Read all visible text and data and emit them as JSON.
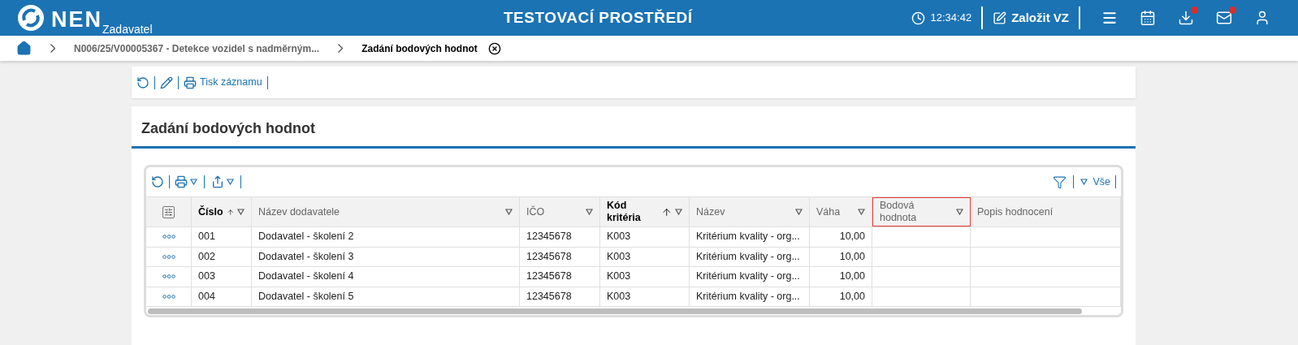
{
  "header": {
    "logo": "NEN",
    "role": "Zadavatel",
    "title": "TESTOVACÍ PROSTŘEDÍ",
    "time": "12:34:42",
    "create_button": "Založit VZ",
    "icons": [
      {
        "kind": "menu",
        "badge": false
      },
      {
        "kind": "calendar",
        "badge": false
      },
      {
        "kind": "download",
        "badge": true
      },
      {
        "kind": "mail",
        "badge": true
      },
      {
        "kind": "user",
        "badge": false
      }
    ]
  },
  "breadcrumb": {
    "items": [
      {
        "label": "N006/25/V00005367 - Detekce vozidel s nadměrným...",
        "current": false
      },
      {
        "label": "Zadání bodových hodnot",
        "current": true
      }
    ]
  },
  "toolbar": {
    "print_label": "Tisk záznamu"
  },
  "section": {
    "title": "Zadání bodových hodnot"
  },
  "grid": {
    "filter_label": "Vše",
    "columns": [
      {
        "label": "Číslo",
        "sorted": true,
        "filterable": true,
        "highlighted": false,
        "kind": "text"
      },
      {
        "label": "Název dodavatele",
        "sorted": false,
        "filterable": true,
        "highlighted": false,
        "kind": "text"
      },
      {
        "label": "IČO",
        "sorted": false,
        "filterable": true,
        "highlighted": false,
        "kind": "text"
      },
      {
        "label": "Kód kritéria",
        "sorted": true,
        "filterable": true,
        "highlighted": false,
        "kind": "text"
      },
      {
        "label": "Název",
        "sorted": false,
        "filterable": true,
        "highlighted": false,
        "kind": "text"
      },
      {
        "label": "Váha",
        "sorted": false,
        "filterable": true,
        "highlighted": false,
        "kind": "number"
      },
      {
        "label": "Bodová hodnota",
        "sorted": false,
        "filterable": true,
        "highlighted": true,
        "kind": "number"
      },
      {
        "label": "Popis hodnocení",
        "sorted": false,
        "filterable": false,
        "highlighted": false,
        "kind": "text"
      }
    ],
    "rows": [
      {
        "cells": [
          "001",
          "Dodavatel - školení 2",
          "12345678",
          "K003",
          "Kritérium kvality - org...",
          "10,00"
        ]
      },
      {
        "cells": [
          "002",
          "Dodavatel - školení 3",
          "12345678",
          "K003",
          "Kritérium kvality - org...",
          "10,00"
        ]
      },
      {
        "cells": [
          "003",
          "Dodavatel - školení 4",
          "12345678",
          "K003",
          "Kritérium kvality - org...",
          "10,00"
        ]
      },
      {
        "cells": [
          "004",
          "Dodavatel - školení 5",
          "12345678",
          "K003",
          "Kritérium kvality - org...",
          "10,00"
        ]
      }
    ]
  }
}
